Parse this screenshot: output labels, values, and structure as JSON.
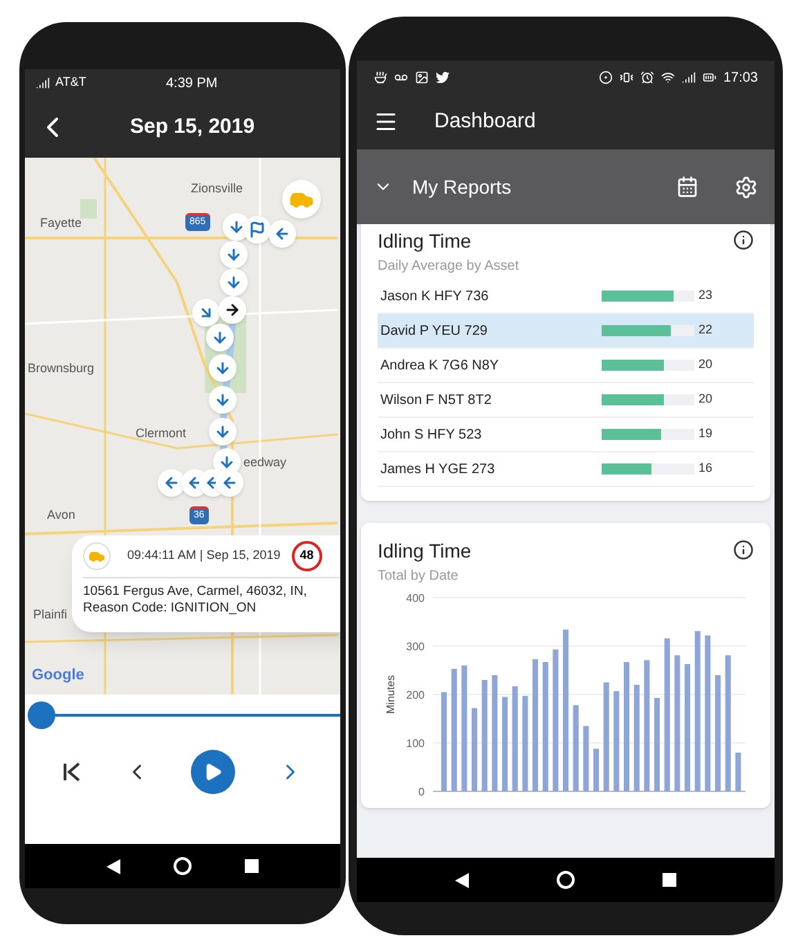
{
  "left_phone": {
    "status_bar": {
      "carrier": "AT&T",
      "time": "4:39 PM"
    },
    "header": {
      "title": "Sep 15, 2019"
    },
    "map": {
      "labels": [
        {
          "text": "Zionsville",
          "kind": "place"
        },
        {
          "text": "Fayette",
          "kind": "place"
        },
        {
          "text": "Brownsburg",
          "kind": "place"
        },
        {
          "text": "Clermont",
          "kind": "place"
        },
        {
          "text": "eedway",
          "kind": "place"
        },
        {
          "text": "Avon",
          "kind": "place"
        },
        {
          "text": "Plainfi",
          "kind": "place"
        },
        {
          "text": "865",
          "kind": "shield"
        },
        {
          "text": "36",
          "kind": "shield"
        }
      ],
      "attribution": "Google",
      "popup": {
        "timestamp": "09:44:11 AM | Sep 15, 2019",
        "count": "48",
        "address": "10561 Fergus Ave, Carmel, 46032, IN,",
        "reason": "Reason Code: IGNITION_ON"
      }
    },
    "timeline": {
      "level": 0
    }
  },
  "right_phone": {
    "status_bar": {
      "time": "17:03"
    },
    "header": {
      "title": "Dashboard"
    },
    "toolbar": {
      "title": "My Reports"
    },
    "asset_card": {
      "title": "Idling Time",
      "subtitle": "Daily Average by Asset",
      "rows": [
        {
          "name": "Jason K HFY 736",
          "value": "23",
          "level": 0.78,
          "selected": false
        },
        {
          "name": "David P YEU 729",
          "value": "22",
          "level": 0.74,
          "selected": true
        },
        {
          "name": "Andrea K 7G6 N8Y",
          "value": "20",
          "level": 0.67,
          "selected": false
        },
        {
          "name": "Wilson F N5T 8T2",
          "value": "20",
          "level": 0.67,
          "selected": false
        },
        {
          "name": "John S HFY 523",
          "value": "19",
          "level": 0.64,
          "selected": false
        },
        {
          "name": "James H YGE 273",
          "value": "16",
          "level": 0.54,
          "selected": false
        }
      ]
    },
    "date_card": {
      "title": "Idling Time",
      "subtitle": "Total by Date",
      "chart_data": {
        "type": "bar",
        "grid": true,
        "ylabel": "Minutes",
        "ylim": [
          0,
          400
        ],
        "yticks": [
          0,
          100,
          200,
          300,
          400
        ],
        "series": [
          {
            "color": "#8ea5d8",
            "values": [
              205,
              253,
              260,
              172,
              230,
              240,
              195,
              217,
              197,
              273,
              267,
              293,
              334,
              178,
              135,
              88,
              225,
              207,
              267,
              220,
              271,
              193,
              316,
              281,
              263,
              331,
              322,
              240,
              281,
              80
            ]
          }
        ]
      }
    }
  }
}
